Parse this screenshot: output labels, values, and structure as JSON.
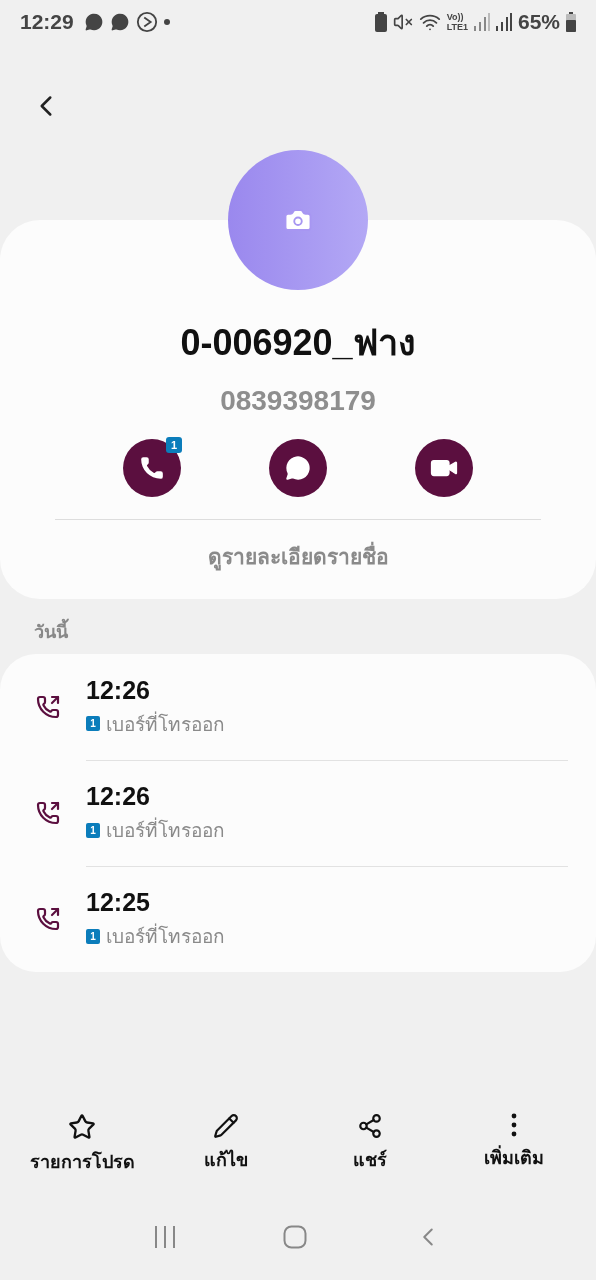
{
  "status_bar": {
    "time": "12:29",
    "network_top": "Vo))",
    "network_bottom": "LTE1",
    "battery": "65%"
  },
  "contact": {
    "name": "0-006920_ฟาง",
    "number": "0839398179",
    "view_details": "ดูรายละเอียดรายชื่อ"
  },
  "quick_actions": [
    {
      "kind": "call",
      "badge": "1"
    },
    {
      "kind": "message"
    },
    {
      "kind": "video"
    }
  ],
  "section_title": "วันนี้",
  "calls": [
    {
      "time": "12:26",
      "sim": "1",
      "label": "เบอร์ที่โทรออก"
    },
    {
      "time": "12:26",
      "sim": "1",
      "label": "เบอร์ที่โทรออก"
    },
    {
      "time": "12:25",
      "sim": "1",
      "label": "เบอร์ที่โทรออก"
    }
  ],
  "bottom_actions": [
    {
      "kind": "favorite",
      "label": "รายการโปรด"
    },
    {
      "kind": "edit",
      "label": "แก้ไข"
    },
    {
      "kind": "share",
      "label": "แชร์"
    },
    {
      "kind": "more",
      "label": "เพิ่มเติม"
    }
  ]
}
